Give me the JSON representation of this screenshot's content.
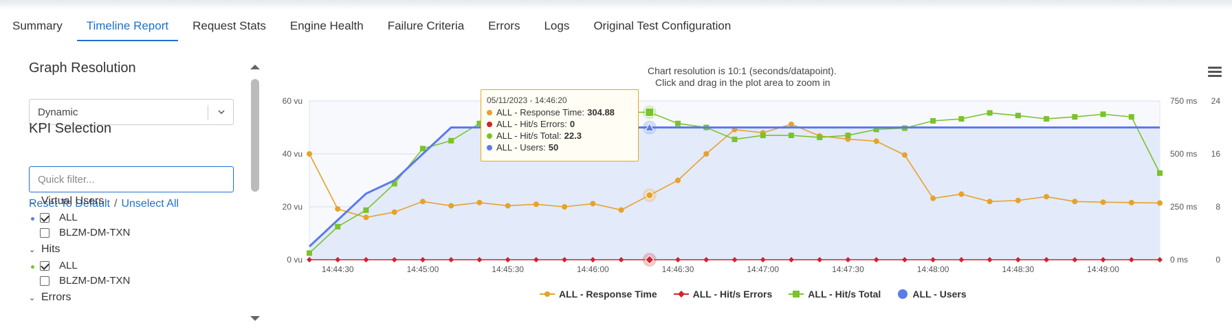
{
  "tabs": [
    {
      "label": "Summary",
      "active": false
    },
    {
      "label": "Timeline Report",
      "active": true
    },
    {
      "label": "Request Stats",
      "active": false
    },
    {
      "label": "Engine Health",
      "active": false
    },
    {
      "label": "Failure Criteria",
      "active": false
    },
    {
      "label": "Errors",
      "active": false
    },
    {
      "label": "Logs",
      "active": false
    },
    {
      "label": "Original Test Configuration",
      "active": false
    }
  ],
  "sidebar": {
    "graph_resolution_title": "Graph Resolution",
    "resolution_value": "Dynamic",
    "kpi_title": "KPI Selection",
    "filter_placeholder": "Quick filter...",
    "reset_link": "Reset To Default",
    "link_separator": "/",
    "unselect_link": "Unselect All",
    "groups": [
      {
        "label": "Virtual Users",
        "items": [
          {
            "label": "ALL",
            "checked": true,
            "dot_color": "#5b7be8"
          },
          {
            "label": "BLZM-DM-TXN",
            "checked": false
          }
        ]
      },
      {
        "label": "Hits",
        "items": [
          {
            "label": "ALL",
            "checked": true,
            "dot_color": "#7ac32a"
          },
          {
            "label": "BLZM-DM-TXN",
            "checked": false
          }
        ]
      },
      {
        "label": "Errors",
        "items": []
      }
    ]
  },
  "chart_header": {
    "line1": "Chart resolution is 10:1 (seconds/datapoint).",
    "line2": "Click and drag in the plot area to zoom in"
  },
  "tooltip": {
    "timestamp": "05/11/2023 - 14:46:20",
    "rows": [
      {
        "label": "ALL - Response Time:",
        "value": "304.88",
        "color": "#e6a22a"
      },
      {
        "label": "ALL - Hit/s Errors:",
        "value": "0",
        "color": "#d0232b"
      },
      {
        "label": "ALL - Hit/s Total:",
        "value": "22.3",
        "color": "#7ac32a"
      },
      {
        "label": "ALL - Users:",
        "value": "50",
        "color": "#5b7be8"
      }
    ]
  },
  "chart_data": {
    "type": "line",
    "x": [
      "14:44:20",
      "14:44:30",
      "14:44:40",
      "14:44:50",
      "14:45:00",
      "14:45:10",
      "14:45:20",
      "14:45:30",
      "14:45:40",
      "14:45:50",
      "14:46:00",
      "14:46:10",
      "14:46:20",
      "14:46:30",
      "14:46:40",
      "14:46:50",
      "14:47:00",
      "14:47:10",
      "14:47:20",
      "14:47:30",
      "14:47:40",
      "14:47:50",
      "14:48:00",
      "14:48:10",
      "14:48:20",
      "14:48:30",
      "14:48:40",
      "14:48:50",
      "14:49:00",
      "14:49:10",
      "14:49:20"
    ],
    "x_ticks": [
      "14:44:30",
      "14:45:00",
      "14:45:30",
      "14:46:00",
      "14:46:30",
      "14:47:00",
      "14:47:30",
      "14:48:00",
      "14:48:30",
      "14:49:00"
    ],
    "axes": {
      "users": {
        "ticks": [
          "0 vu",
          "20 vu",
          "40 vu",
          "60 vu"
        ],
        "range": [
          0,
          60
        ]
      },
      "response_time": {
        "ticks": [
          "0 ms",
          "250 ms",
          "500 ms",
          "750 ms"
        ],
        "range": [
          0,
          750
        ]
      },
      "hits": {
        "ticks": [
          "0",
          "8",
          "16",
          "24"
        ],
        "range": [
          0,
          24
        ]
      }
    },
    "series": [
      {
        "name": "ALL - Response Time",
        "axis": "response_time",
        "color": "#e6a22a",
        "marker": "circle",
        "values": [
          500,
          240,
          200,
          225,
          275,
          255,
          270,
          255,
          262,
          250,
          265,
          235,
          304.88,
          375,
          500,
          615,
          600,
          640,
          585,
          570,
          560,
          495,
          290,
          310,
          275,
          280,
          298,
          275,
          272,
          270,
          268
        ]
      },
      {
        "name": "ALL - Hit/s Errors",
        "axis": "hits",
        "color": "#d0232b",
        "marker": "diamond",
        "values": [
          0,
          0,
          0,
          0,
          0,
          0,
          0,
          0,
          0,
          0,
          0,
          0,
          0,
          0,
          0,
          0,
          0,
          0,
          0,
          0,
          0,
          0,
          0,
          0,
          0,
          0,
          0,
          0,
          0,
          0,
          0
        ]
      },
      {
        "name": "ALL - Hit/s Total",
        "axis": "hits",
        "color": "#7ac32a",
        "marker": "square",
        "values": [
          1,
          5,
          7.5,
          11.5,
          16.8,
          18,
          20.6,
          21.7,
          21.5,
          21.2,
          21.7,
          22.3,
          22.3,
          20.6,
          20.0,
          18.2,
          18.8,
          18.8,
          18.5,
          18.8,
          19.7,
          19.9,
          21.0,
          21.3,
          22.2,
          21.8,
          21.3,
          21.6,
          22.0,
          21.6,
          13.1
        ]
      },
      {
        "name": "ALL - Users",
        "axis": "users",
        "color": "#5b7be8",
        "marker": "triangle",
        "values": [
          5,
          15,
          25,
          30,
          40,
          50,
          50,
          50,
          50,
          50,
          50,
          50,
          50,
          50,
          50,
          50,
          50,
          50,
          50,
          50,
          50,
          50,
          50,
          50,
          50,
          50,
          50,
          50,
          50,
          50,
          50
        ]
      }
    ],
    "highlight_index": 12,
    "legend": [
      "ALL - Response Time",
      "ALL - Hit/s Errors",
      "ALL - Hit/s Total",
      "ALL - Users"
    ],
    "legend_placement": "bottom",
    "grid": true
  }
}
